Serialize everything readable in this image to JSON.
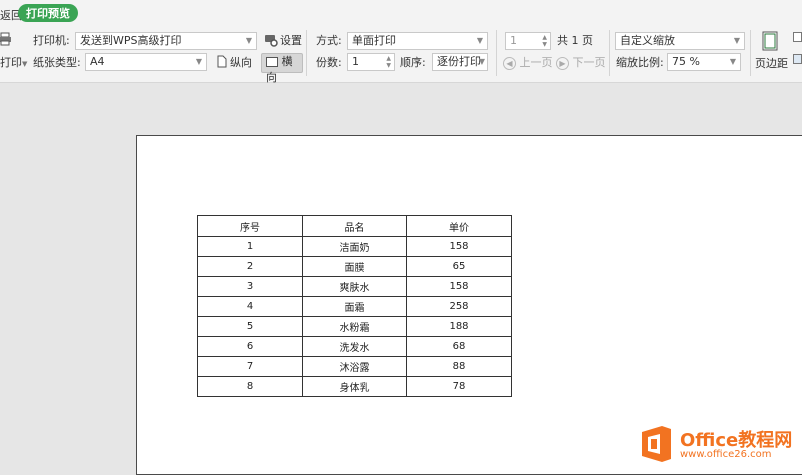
{
  "topbar": {
    "back_label": "返回",
    "tab_label": "打印预览"
  },
  "ribbon": {
    "print_label": "打印",
    "printer_label": "打印机:",
    "printer_value": "发送到WPS高级打印",
    "settings_label": "设置",
    "paper_type_label": "纸张类型:",
    "paper_type_value": "A4",
    "portrait_label": "纵向",
    "landscape_label": "横向",
    "mode_label": "方式:",
    "mode_value": "单面打印",
    "copies_label": "份数:",
    "copies_value": "1",
    "order_label": "顺序:",
    "order_value": "逐份打印",
    "page_number_value": "1",
    "total_pages_label": "共 1 页",
    "prev_page_label": "上一页",
    "next_page_label": "下一页",
    "zoom_mode_value": "自定义缩放",
    "zoom_ratio_label": "缩放比例:",
    "zoom_ratio_value": "75 %",
    "margins_label": "页边距"
  },
  "table": {
    "headers": [
      "序号",
      "品名",
      "单价"
    ],
    "rows": [
      [
        "1",
        "洁面奶",
        "158"
      ],
      [
        "2",
        "面膜",
        "65"
      ],
      [
        "3",
        "爽肤水",
        "158"
      ],
      [
        "4",
        "面霜",
        "258"
      ],
      [
        "5",
        "水粉霜",
        "188"
      ],
      [
        "6",
        "洗发水",
        "68"
      ],
      [
        "7",
        "沐浴露",
        "88"
      ],
      [
        "8",
        "身体乳",
        "78"
      ]
    ]
  },
  "watermark": {
    "brand": "Office教程网",
    "url": "www.office26.com"
  },
  "colors": {
    "accent_green": "#3aa454",
    "watermark_orange": "#f27321",
    "workspace_gray": "#e6e6e6"
  }
}
